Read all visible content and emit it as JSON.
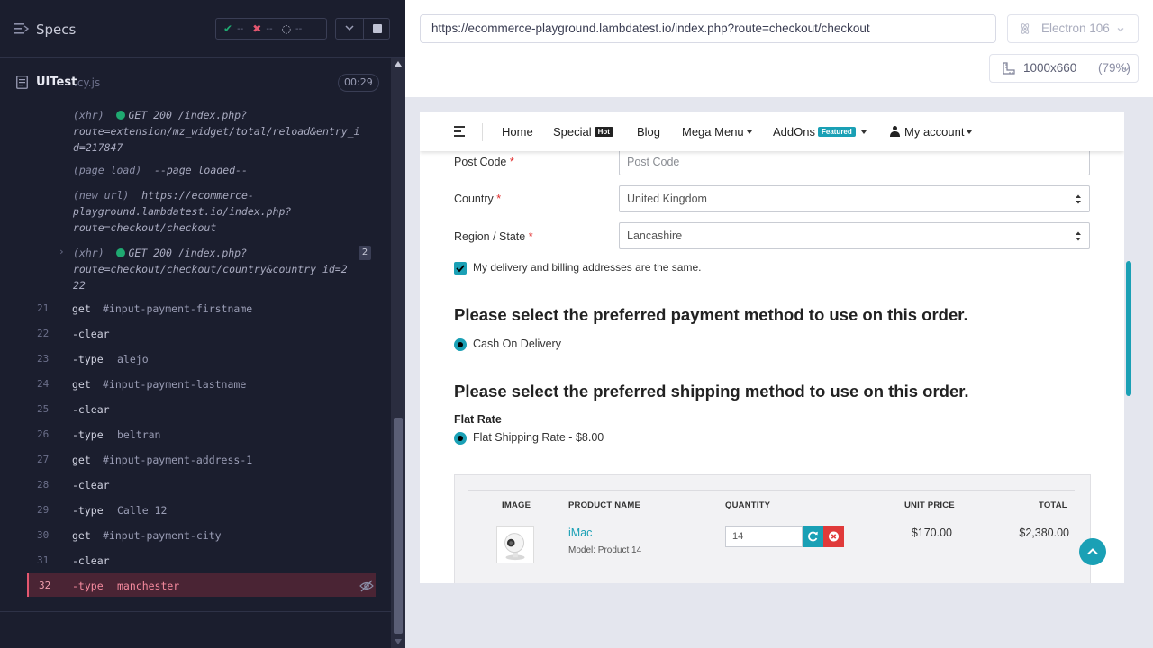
{
  "reporter": {
    "specs_label": "Specs",
    "stats": {
      "passed": "--",
      "failed": "--",
      "pending": "--"
    },
    "file": {
      "name": "UITest",
      "ext": ".cy.js",
      "duration": "00:29"
    },
    "events": [
      {
        "type": "(xhr)",
        "lines": [
          "GET 200 /index.php?",
          "route=extension/mz_widget/total/reload&entry_i",
          "d=217847"
        ]
      },
      {
        "type": "(page load)",
        "lines": [
          "--page loaded--"
        ]
      },
      {
        "type": "(new url)",
        "lines": [
          "https://ecommerce-",
          "playground.lambdatest.io/index.php?",
          "route=checkout/checkout"
        ]
      },
      {
        "type": "(xhr)",
        "lines": [
          "GET 200 /index.php?",
          "route=checkout/checkout/country&country_id=2",
          "22"
        ],
        "count": "2"
      }
    ],
    "commands": [
      {
        "num": "21",
        "name": "get",
        "arg": "#input-payment-firstname"
      },
      {
        "num": "22",
        "name": "-clear",
        "arg": ""
      },
      {
        "num": "23",
        "name": "-type",
        "arg": "alejo"
      },
      {
        "num": "24",
        "name": "get",
        "arg": "#input-payment-lastname"
      },
      {
        "num": "25",
        "name": "-clear",
        "arg": ""
      },
      {
        "num": "26",
        "name": "-type",
        "arg": "beltran"
      },
      {
        "num": "27",
        "name": "get",
        "arg": "#input-payment-address-1"
      },
      {
        "num": "28",
        "name": "-clear",
        "arg": ""
      },
      {
        "num": "29",
        "name": "-type",
        "arg": "Calle 12"
      },
      {
        "num": "30",
        "name": "get",
        "arg": "#input-payment-city"
      },
      {
        "num": "31",
        "name": "-clear",
        "arg": ""
      },
      {
        "num": "32",
        "name": "-type",
        "arg": "manchester"
      }
    ]
  },
  "runner": {
    "url": "https://ecommerce-playground.lambdatest.io/index.php?route=checkout/checkout",
    "browser": "Electron 106",
    "viewport": "1000x660",
    "zoom": "(79%)"
  },
  "app": {
    "nav": {
      "home": "Home",
      "special": "Special",
      "special_badge": "Hot",
      "blog": "Blog",
      "mega_menu": "Mega Menu",
      "addons": "AddOns",
      "addons_badge": "Featured",
      "account": "My account"
    },
    "form": {
      "postcode_label": "Post Code",
      "postcode_placeholder": "Post Code",
      "country_label": "Country",
      "country_value": "United Kingdom",
      "region_label": "Region / State",
      "region_value": "Lancashire",
      "required_mark": "*",
      "same_address_label": "My delivery and billing addresses are the same."
    },
    "payment_heading": "Please select the preferred payment method to use on this order.",
    "payment_option": "Cash On Delivery",
    "shipping_heading": "Please select the preferred shipping method to use on this order.",
    "shipping_group": "Flat Rate",
    "shipping_option": "Flat Shipping Rate - $8.00",
    "cart": {
      "headers": {
        "image": "IMAGE",
        "product": "PRODUCT NAME",
        "quantity": "QUANTITY",
        "unit_price": "UNIT PRICE",
        "total": "TOTAL"
      },
      "row": {
        "name": "iMac",
        "model": "Model: Product 14",
        "quantity": "14",
        "unit_price": "$170.00",
        "total": "$2,380.00"
      }
    }
  },
  "colors": {
    "accent": "#1aa0b5",
    "danger": "#e03a3a",
    "active_cmd": "#4a2434",
    "reporter_bg": "#1b1e2e"
  }
}
